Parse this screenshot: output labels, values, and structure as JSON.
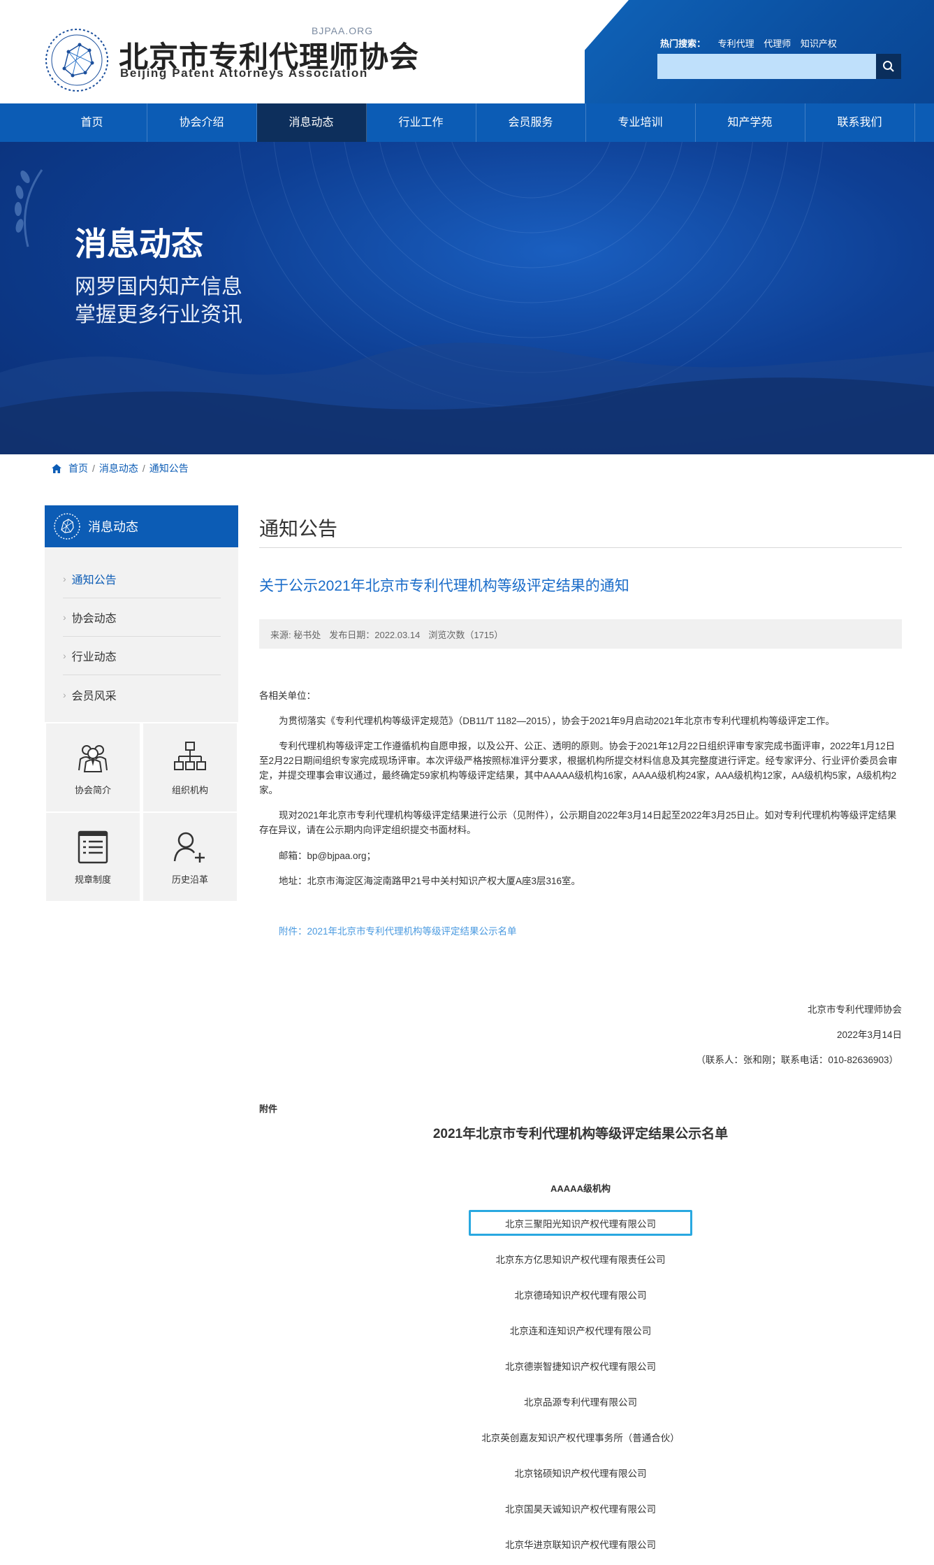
{
  "header": {
    "site_domain": "BJPAA.ORG",
    "title_cn": "北京市专利代理师协会",
    "title_en": "Beijing Patent Attorneys Association",
    "hot_label": "热门搜索：",
    "hot_terms": [
      "专利代理",
      "代理师",
      "知识产权"
    ],
    "search_placeholder": "",
    "search_icon": "search-icon"
  },
  "nav": {
    "items": [
      "首页",
      "协会介绍",
      "消息动态",
      "行业工作",
      "会员服务",
      "专业培训",
      "知产学苑",
      "联系我们"
    ],
    "active": "消息动态"
  },
  "banner": {
    "title": "消息动态",
    "line1": "网罗国内知产信息",
    "line2": "掌握更多行业资讯"
  },
  "breadcrumb": [
    "首页",
    "消息动态",
    "通知公告"
  ],
  "sidebar": {
    "title": "消息动态",
    "items": [
      "通知公告",
      "协会动态",
      "行业动态",
      "会员风采"
    ],
    "active": "通知公告",
    "tiles": [
      {
        "label": "协会简介",
        "icon": "members-icon"
      },
      {
        "label": "组织机构",
        "icon": "org-chart-icon"
      },
      {
        "label": "规章制度",
        "icon": "document-list-icon"
      },
      {
        "label": "历史沿革",
        "icon": "user-add-icon"
      }
    ]
  },
  "main": {
    "section_title": "通知公告",
    "article_title": "关于公示2021年北京市专利代理机构等级评定结果的通知",
    "meta": {
      "source": "来源: 秘书处",
      "date": "发布日期：2022.03.14",
      "views": "浏览次数（1715）"
    },
    "greeting": "各相关单位：",
    "p1": "为贯彻落实《专利代理机构等级评定规范》（DB11/T 1182—2015），协会于2021年9月启动2021年北京市专利代理机构等级评定工作。",
    "p2": "专利代理机构等级评定工作遵循机构自愿申报，以及公开、公正、透明的原则。协会于2021年12月22日组织评审专家完成书面评审，2022年1月12日至2月22日期间组织专家完成现场评审。本次评级严格按照标准评分要求，根据机构所提交材料信息及其完整度进行评定。经专家评分、行业评价委员会审定，并提交理事会审议通过，最终确定59家机构等级评定结果，其中AAAAA级机构16家，AAAA级机构24家，AAA级机构12家，AA级机构5家，A级机构2家。",
    "p3": "现对2021年北京市专利代理机构等级评定结果进行公示（见附件），公示期自2022年3月14日起至2022年3月25日止。如对专利代理机构等级评定结果存在异议，请在公示期内向评定组织提交书面材料。",
    "email": "邮箱：bp@bjpaa.org；",
    "address": "地址：北京市海淀区海淀南路甲21号中关村知识产权大厦A座3层316室。",
    "attachment_link": "附件：2021年北京市专利代理机构等级评定结果公示名单",
    "sign_org": "北京市专利代理师协会",
    "sign_date": "2022年3月14日",
    "sign_contact": "（联系人：张和刚；联系电话：010-82636903）",
    "annex_label": "附件",
    "annex_title": "2021年北京市专利代理机构等级评定结果公示名单",
    "grade_label": "AAAAA级机构",
    "firms": [
      "北京三聚阳光知识产权代理有限公司",
      "北京东方亿思知识产权代理有限责任公司",
      "北京德琦知识产权代理有限公司",
      "北京连和连知识产权代理有限公司",
      "北京德崇智捷知识产权代理有限公司",
      "北京品源专利代理有限公司",
      "北京英创嘉友知识产权代理事务所（普通合伙）",
      "北京铭硕知识产权代理有限公司",
      "北京国昊天诚知识产权代理有限公司",
      "北京华进京联知识产权代理有限公司"
    ]
  },
  "colors": {
    "brand_blue": "#0c5cb5",
    "nav_active": "#0d2f5c",
    "link_blue": "#1a6cc9",
    "highlight_border": "#29a8e0"
  }
}
